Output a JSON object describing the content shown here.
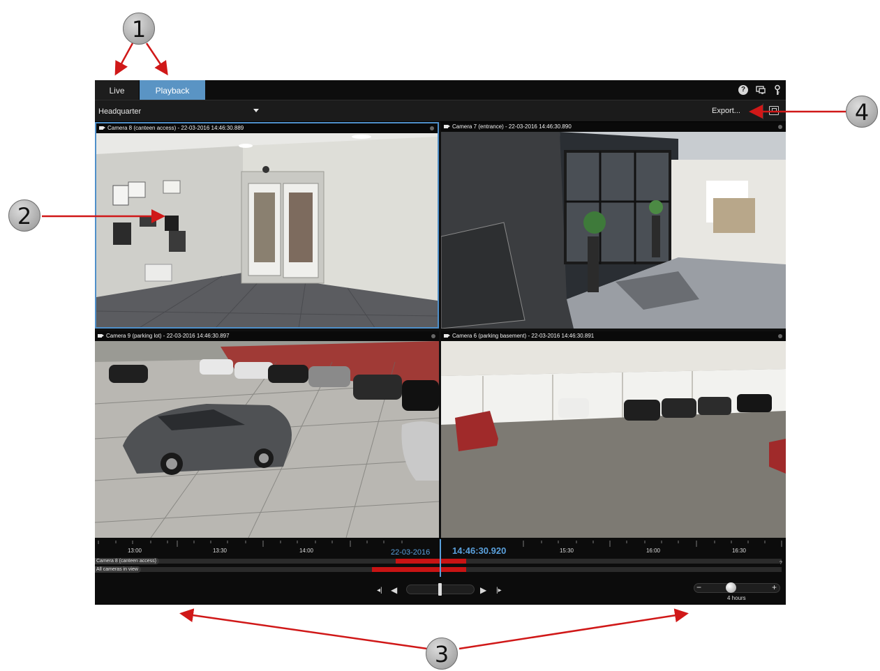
{
  "tabs": [
    {
      "label": "Live",
      "active": false
    },
    {
      "label": "Playback",
      "active": true
    }
  ],
  "header_icons": [
    "help-icon",
    "monitor-icon",
    "key-icon"
  ],
  "toolbar": {
    "view_name": "Headquarter",
    "export_label": "Export..."
  },
  "cameras": [
    {
      "header": "Camera 8 (canteen access) - 22-03-2016 14:46:30.889",
      "selected": true
    },
    {
      "header": "Camera 7 (entrance) - 22-03-2016 14:46:30.890",
      "selected": false
    },
    {
      "header": "Camera 9 (parking lot) - 22-03-2016 14:46:30.897",
      "selected": false
    },
    {
      "header": "Camera 6 (parking basement) - 22-03-2016 14:46:30.891",
      "selected": false
    }
  ],
  "timeline": {
    "hours": [
      "13:00",
      "13:30",
      "14:00",
      "15:30",
      "16:00",
      "16:30"
    ],
    "date": "22-03-2016",
    "current_time": "14:46:30.920",
    "tracks": [
      {
        "label": "Camera 8 (canteen access)"
      },
      {
        "label": "All cameras in view"
      }
    ],
    "help_mark": "?",
    "zoom_label": "4 hours",
    "zoom_minus": "−",
    "zoom_plus": "+"
  },
  "callouts": [
    "1",
    "2",
    "3",
    "4"
  ],
  "colors": {
    "accent": "#5a94c4",
    "recording": "#c81414",
    "callout_arrow": "#d01818"
  }
}
